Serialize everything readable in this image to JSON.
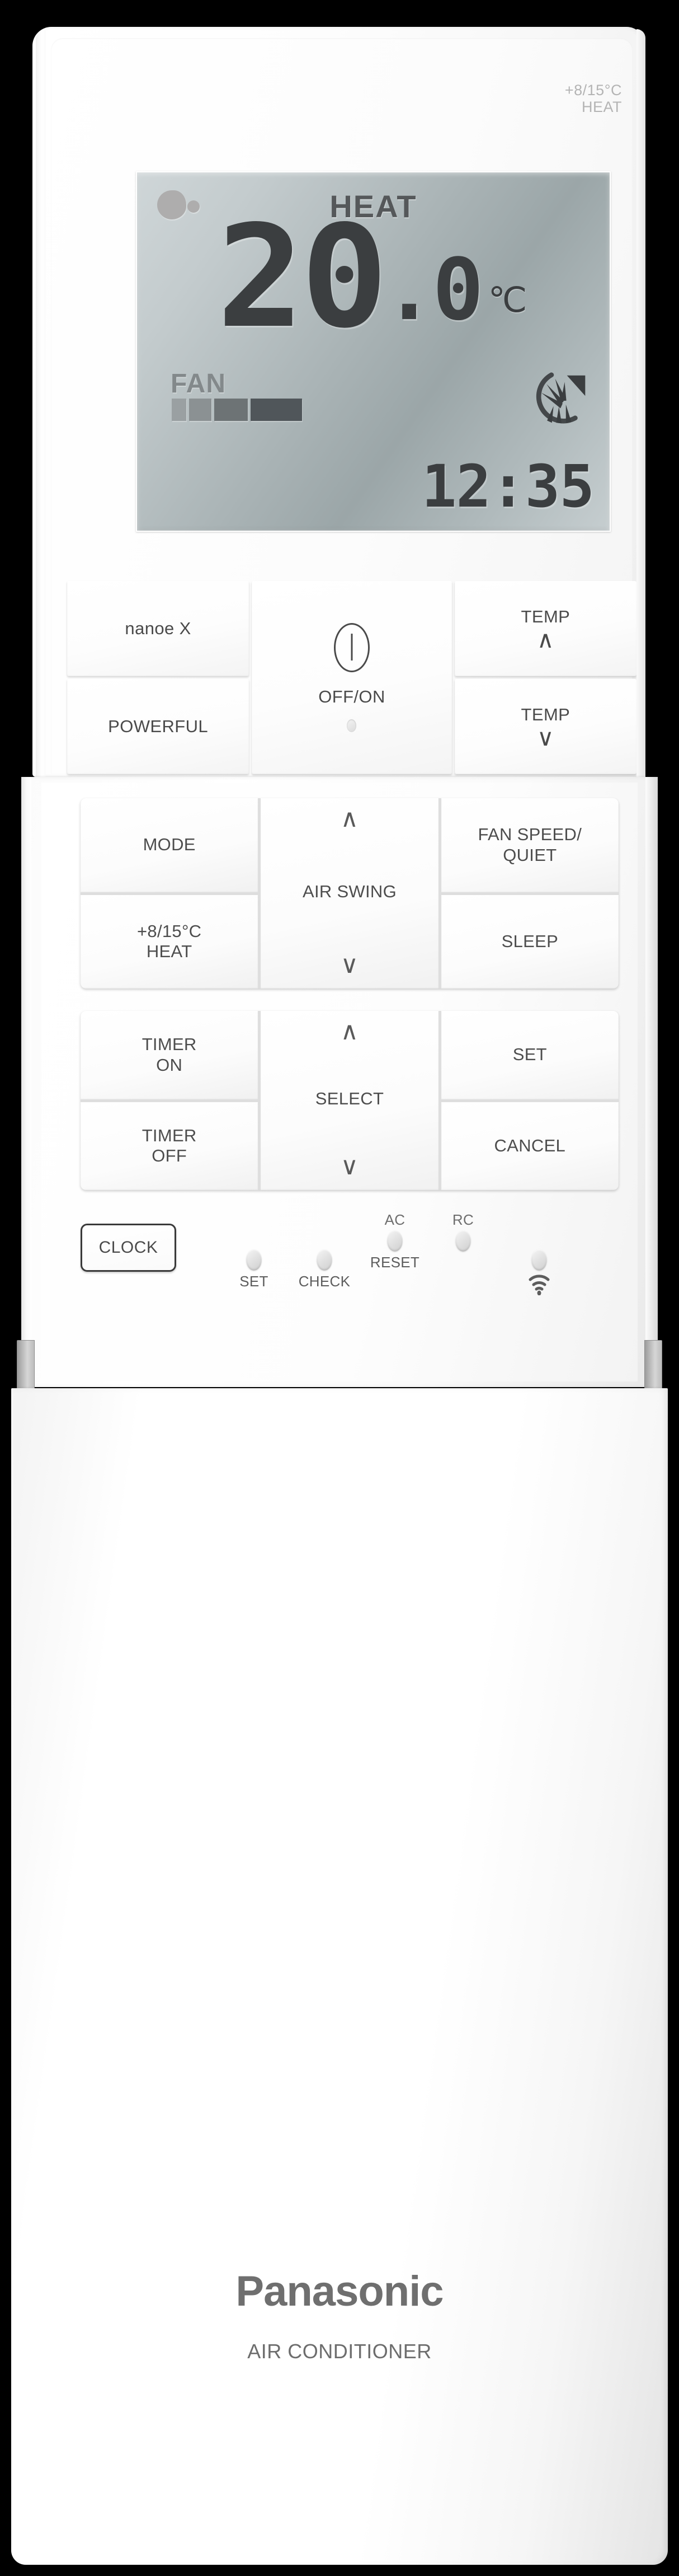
{
  "device": {
    "brand": "Panasonic",
    "subtitle": "AIR CONDITIONER",
    "corner_label": "+8/15°C\nHEAT"
  },
  "display": {
    "mode": "HEAT",
    "temperature_integer": "20",
    "temperature_decimal": ".0",
    "unit": "℃",
    "fan_label": "FAN",
    "fan_bars_active": 4,
    "fan_bars_total": 4,
    "clock": "12:35",
    "nanoe_icon": "nanoe-particle-icon",
    "airflow_icon": "airflow-fan-icon"
  },
  "top_buttons": {
    "nanoe": "nanoe X",
    "powerful": "POWERFUL",
    "power": "OFF/ON",
    "power_icon": "power-icon",
    "temp_up": "TEMP",
    "temp_up_arrow": "∧",
    "temp_down": "TEMP",
    "temp_down_arrow": "∨"
  },
  "mode_block": {
    "mode": "MODE",
    "heat_8_15": "+8/15°C\nHEAT",
    "air_swing": "AIR SWING",
    "air_swing_up": "∧",
    "air_swing_down": "∨",
    "fan_speed": "FAN SPEED/\nQUIET",
    "sleep": "SLEEP"
  },
  "timer_block": {
    "timer_on": "TIMER\nON",
    "timer_off": "TIMER\nOFF",
    "select": "SELECT",
    "select_up": "∧",
    "select_down": "∨",
    "set": "SET",
    "cancel": "CANCEL"
  },
  "bottom_row": {
    "clock_button": "CLOCK",
    "indicators": [
      {
        "cap": "",
        "label": "SET"
      },
      {
        "cap": "",
        "label": "CHECK"
      },
      {
        "cap": "AC",
        "label": "RESET"
      },
      {
        "cap": "RC",
        "label": ""
      },
      {
        "cap": "",
        "label": "",
        "icon": "wifi-icon"
      }
    ]
  },
  "colors": {
    "body": "#ffffff",
    "lcd": "#a9b3b5",
    "lcd_text": "#3b3e40",
    "button_text": "#4a4a4a",
    "brand_text": "#6f6f6f"
  }
}
